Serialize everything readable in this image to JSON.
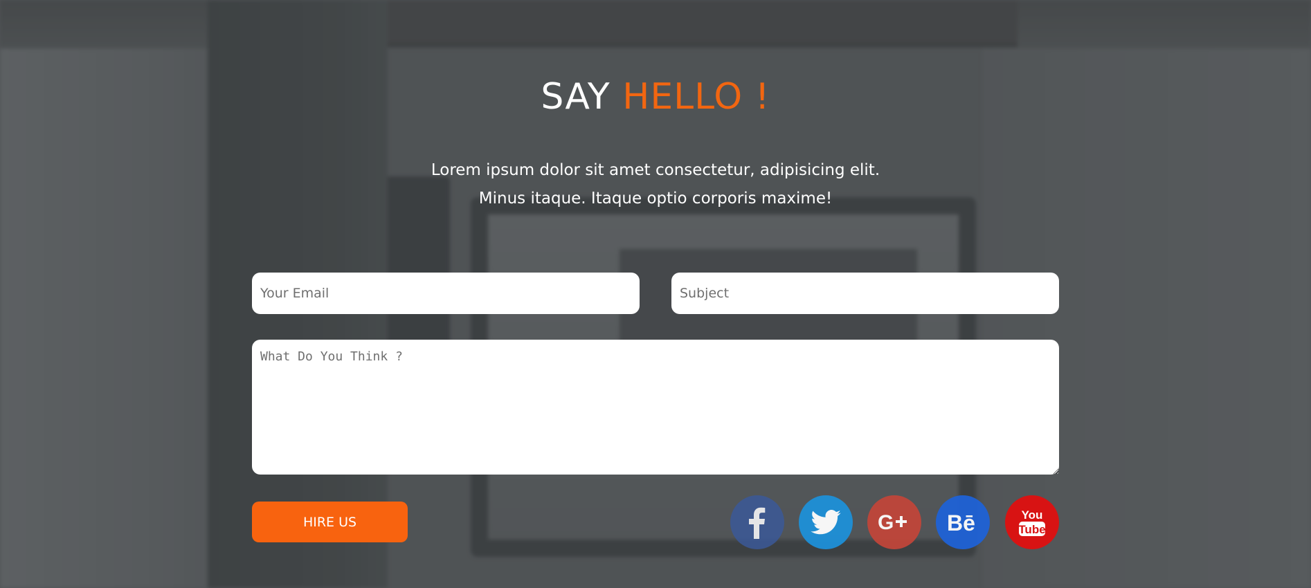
{
  "header": {
    "title_plain": "SAY",
    "title_accent": "HELLO !"
  },
  "intro": {
    "line1": "Lorem ipsum dolor sit amet consectetur, adipisicing elit.",
    "line2": "Minus itaque. Itaque optio corporis maxime!"
  },
  "form": {
    "email_placeholder": "Your Email",
    "email_value": "",
    "subject_placeholder": "Subject",
    "subject_value": "",
    "message_placeholder": "What Do You Think ?",
    "message_value": "",
    "submit_label": "HIRE US"
  },
  "social": [
    {
      "name": "facebook",
      "icon": "facebook-icon",
      "color": "#3b5998"
    },
    {
      "name": "twitter",
      "icon": "twitter-icon",
      "color": "#1e90d8"
    },
    {
      "name": "google-plus",
      "icon": "google-plus-icon",
      "color": "#c0463a"
    },
    {
      "name": "behance",
      "icon": "behance-icon",
      "color": "#1f62d6"
    },
    {
      "name": "youtube",
      "icon": "youtube-icon",
      "color": "#d81313"
    }
  ],
  "colors": {
    "accent": "#f26611",
    "button": "#f8630f",
    "text": "#ffffff"
  }
}
